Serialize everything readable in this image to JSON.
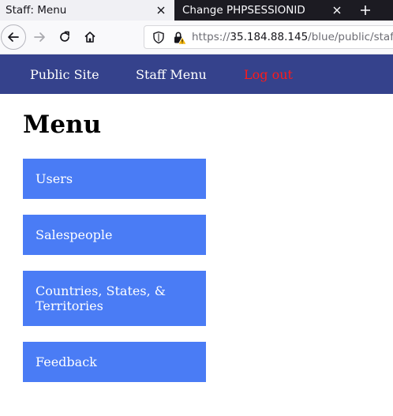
{
  "browser": {
    "tabs": [
      {
        "title": "Staff: Menu",
        "active": true
      },
      {
        "title": "Change PHPSESSIONID",
        "active": false
      }
    ],
    "url": {
      "prefix": "https://",
      "host": "35.184.88.145",
      "path": "/blue/public/staf"
    },
    "icons": [
      "back-icon",
      "forward-icon",
      "reload-icon",
      "home-icon",
      "shield-icon",
      "insecure-lock-icon",
      "close-icon",
      "plus-icon"
    ],
    "colors": {
      "tabbar": "#1c1b22",
      "active_tab": "#f0f0f4",
      "lock_warning": "#f4b400"
    }
  },
  "site_nav": {
    "items": [
      "Public Site",
      "Staff Menu",
      "Log out"
    ],
    "colors": {
      "background": "#35428c",
      "link": "#ffffff",
      "logout": "#ff1a1a"
    }
  },
  "main": {
    "title": "Menu",
    "menu_items": [
      "Users",
      "Salespeople",
      "Countries, States, & Territories",
      "Feedback"
    ],
    "colors": {
      "button": "#4a7cf5",
      "button_text": "#ffffff"
    }
  }
}
